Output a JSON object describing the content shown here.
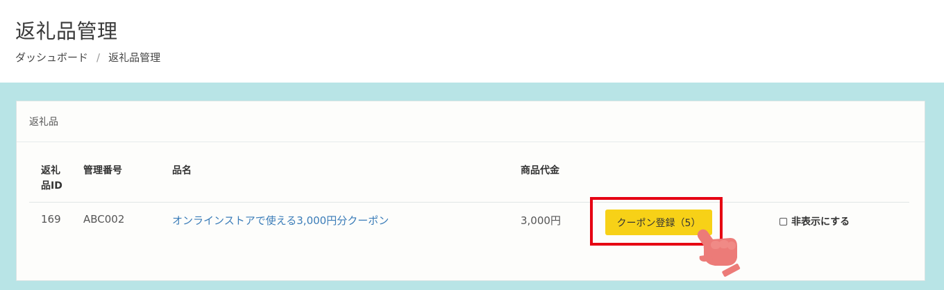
{
  "header": {
    "title": "返礼品管理",
    "breadcrumb": [
      {
        "label": "ダッシュボード"
      },
      {
        "label": "返礼品管理"
      }
    ],
    "breadcrumb_separator": "/"
  },
  "card": {
    "title": "返礼品",
    "columns": {
      "id": "返礼品ID",
      "code": "管理番号",
      "name": "品名",
      "price": "商品代金"
    },
    "rows": [
      {
        "id": "169",
        "code": "ABC002",
        "name": "オンラインストアで使える3,000円分クーポン",
        "price": "3,000円",
        "coupon_button": "クーポン登録（5）",
        "hide_label": "非表示にする"
      }
    ]
  },
  "colors": {
    "accent_background": "#b8e4e6",
    "button": "#f7d117",
    "highlight": "#e60012",
    "link": "#3a7cb8"
  },
  "icons": {
    "hand": "pointing-hand-icon",
    "checkbox": "checkbox-icon"
  }
}
